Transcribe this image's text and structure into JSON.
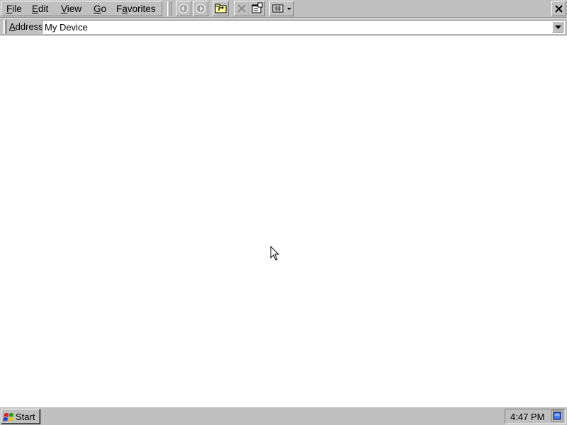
{
  "menu": {
    "file": {
      "pre": "",
      "key": "F",
      "post": "ile"
    },
    "edit": {
      "pre": "",
      "key": "E",
      "post": "dit"
    },
    "view": {
      "pre": "",
      "key": "V",
      "post": "iew"
    },
    "go": {
      "pre": "",
      "key": "G",
      "post": "o"
    },
    "favorites": {
      "pre": "F",
      "key": "a",
      "post": "vorites"
    }
  },
  "toolbar": {
    "icons": [
      "back-arrow-icon",
      "forward-arrow-icon",
      "up-folder-icon",
      "delete-icon",
      "properties-icon",
      "views-icon"
    ]
  },
  "address": {
    "label_key": "A",
    "label_rest": "ddress",
    "value": "My Device"
  },
  "taskbar": {
    "start_label": "Start",
    "clock": "4:47 PM"
  },
  "colors": {
    "chrome": "#c0c0c0",
    "content_bg": "#ffffff"
  }
}
